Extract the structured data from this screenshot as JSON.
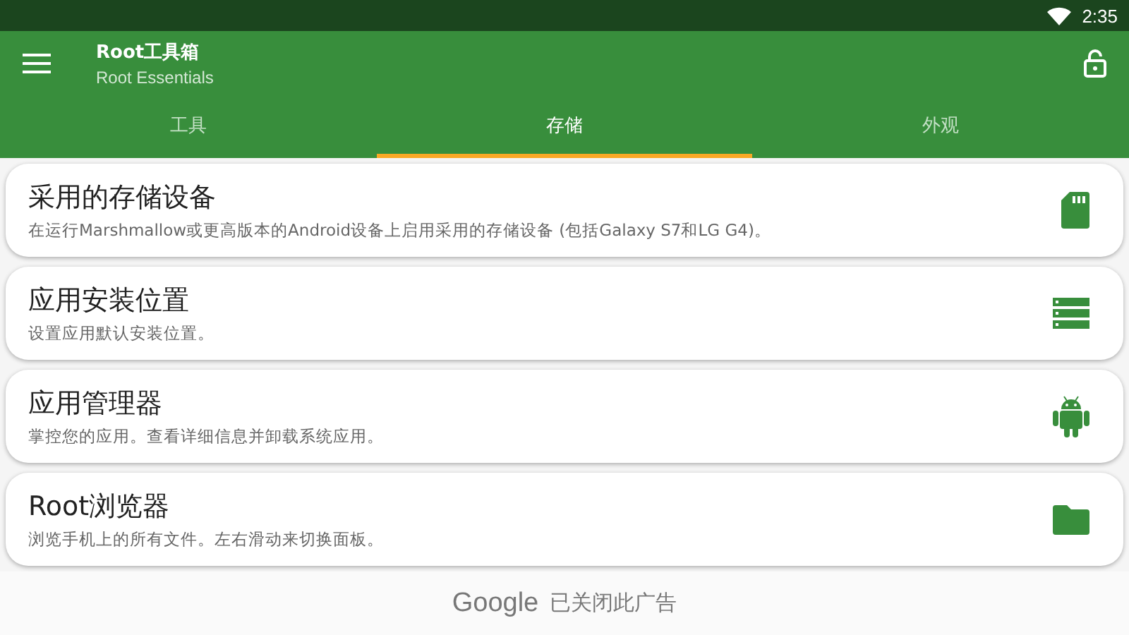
{
  "status_bar": {
    "time": "2:35"
  },
  "app_bar": {
    "title": "Root工具箱",
    "subtitle": "Root Essentials"
  },
  "tabs": [
    {
      "label": "工具",
      "selected": false
    },
    {
      "label": "存储",
      "selected": true
    },
    {
      "label": "外观",
      "selected": false
    }
  ],
  "cards": [
    {
      "title": "采用的存储设备",
      "description": "在运行Marshmallow或更高版本的Android设备上启用采用的存储设备 (包括Galaxy S7和LG G4)。",
      "kind": "sdcard"
    },
    {
      "title": "应用安装位置",
      "description": "设置应用默认安装位置。",
      "kind": "storage"
    },
    {
      "title": "应用管理器",
      "description": "掌控您的应用。查看详细信息并卸载系统应用。",
      "kind": "android"
    },
    {
      "title": "Root浏览器",
      "description": "浏览手机上的所有文件。左右滑动来切换面板。",
      "kind": "folder"
    }
  ],
  "ad_bar": {
    "brand": "Google",
    "message": "已关闭此广告"
  }
}
